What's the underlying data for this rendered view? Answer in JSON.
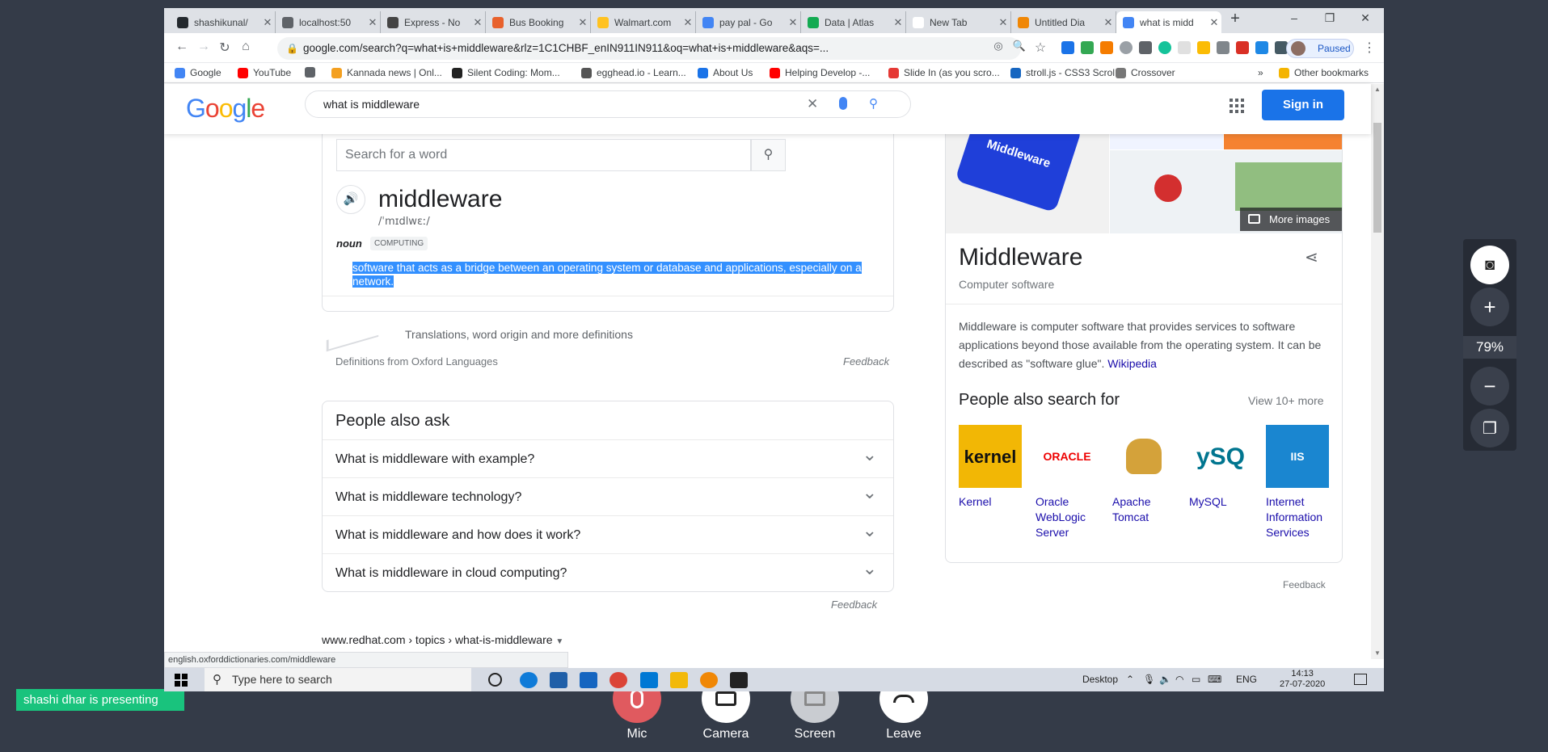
{
  "tabs": [
    {
      "title": "shashikunal/",
      "icon": "github-icon",
      "color": "#24292e"
    },
    {
      "title": "localhost:50",
      "icon": "globe-icon",
      "color": "#5f6368"
    },
    {
      "title": "Express - No",
      "icon": "express-icon",
      "color": "#444444"
    },
    {
      "title": "Bus Booking",
      "icon": "bus-icon",
      "color": "#e8612c"
    },
    {
      "title": "Walmart.com",
      "icon": "walmart-icon",
      "color": "#ffc220"
    },
    {
      "title": "pay pal - Go",
      "icon": "google-icon",
      "color": "#4285f4"
    },
    {
      "title": "Data | Atlas",
      "icon": "mongodb-leaf-icon",
      "color": "#13aa52"
    },
    {
      "title": "New Tab",
      "icon": "none",
      "color": "#ffffff"
    },
    {
      "title": "Untitled Dia",
      "icon": "drawio-icon",
      "color": "#f08705"
    },
    {
      "title": "what is midd",
      "icon": "google-icon",
      "color": "#4285f4",
      "active": true
    }
  ],
  "browser": {
    "url": "google.com/search?q=what+is+middleware&rlz=1C1CHBF_enIN911IN911&oq=what+is+middleware&aqs=...",
    "profile_status": "Paused",
    "new_tab": "+",
    "minimize": "–",
    "restore": "❐",
    "close": "✕"
  },
  "bookmarks": [
    {
      "label": "Google",
      "color": "#4285f4"
    },
    {
      "label": "YouTube",
      "color": "#ff0000"
    },
    {
      "label": "",
      "color": "#5f6368"
    },
    {
      "label": "Kannada news | Onl...",
      "color": "#f4a020"
    },
    {
      "label": "Silent Coding: Mom...",
      "color": "#222222"
    },
    {
      "label": "egghead.io - Learn...",
      "color": "#555555"
    },
    {
      "label": "About Us",
      "color": "#1a73e8"
    },
    {
      "label": "Helping Develop -...",
      "color": "#ff0000"
    },
    {
      "label": "Slide In (as you scro...",
      "color": "#e53935"
    },
    {
      "label": "stroll.js - CSS3 Scrol...",
      "color": "#1565c0"
    },
    {
      "label": "Crossover",
      "color": "#777777"
    },
    {
      "label": "»",
      "color": ""
    },
    {
      "label": "Other bookmarks",
      "color": "#f4b400"
    }
  ],
  "google": {
    "query": "what is middleware",
    "sign_in": "Sign in"
  },
  "dictionary": {
    "search_placeholder": "Search for a word",
    "word": "middleware",
    "phonetic": "/ˈmɪdlwɛː/",
    "pos": "noun",
    "tag": "COMPUTING",
    "definition": "software that acts as a bridge between an operating system or database and applications, especially on a network.",
    "more_link": "Translations, word origin and more definitions",
    "source": "Definitions from Oxford Languages",
    "feedback": "Feedback"
  },
  "people_also_ask": {
    "heading": "People also ask",
    "questions": [
      "What is middleware with example?",
      "What is middleware technology?",
      "What is middleware and how does it work?",
      "What is middleware in cloud computing?"
    ],
    "feedback": "Feedback"
  },
  "result": {
    "breadcrumb": "www.redhat.com › topics › what-is-middleware"
  },
  "knowledge_panel": {
    "more_images": "More images",
    "image_label": "Middleware",
    "title": "Middleware",
    "subtitle": "Computer software",
    "description": "Middleware is computer software that provides services to software applications beyond those available from the operating system. It can be described as \"software glue\".",
    "wiki_link": "Wikipedia",
    "also_search_heading": "People also search for",
    "view_more": "View 10+ more",
    "items": [
      {
        "label": "Kernel",
        "img_text": "kernel"
      },
      {
        "label": "Oracle WebLogic Server",
        "img_text": "ORACLE"
      },
      {
        "label": "Apache Tomcat",
        "img_text": ""
      },
      {
        "label": "MySQL",
        "img_text": "ySQ"
      },
      {
        "label": "Internet Information Services",
        "img_text": "IIS"
      }
    ],
    "feedback": "Feedback"
  },
  "status_url": "english.oxforddictionaries.com/middleware",
  "taskbar": {
    "search_placeholder": "Type here to search",
    "desktop": "Desktop",
    "lang": "ENG",
    "time": "14:13",
    "date": "27-07-2020"
  },
  "meeting": {
    "presenting": "shashi dhar is presenting",
    "mic": "Mic",
    "camera": "Camera",
    "screen": "Screen",
    "leave": "Leave",
    "zoom": "79%"
  }
}
